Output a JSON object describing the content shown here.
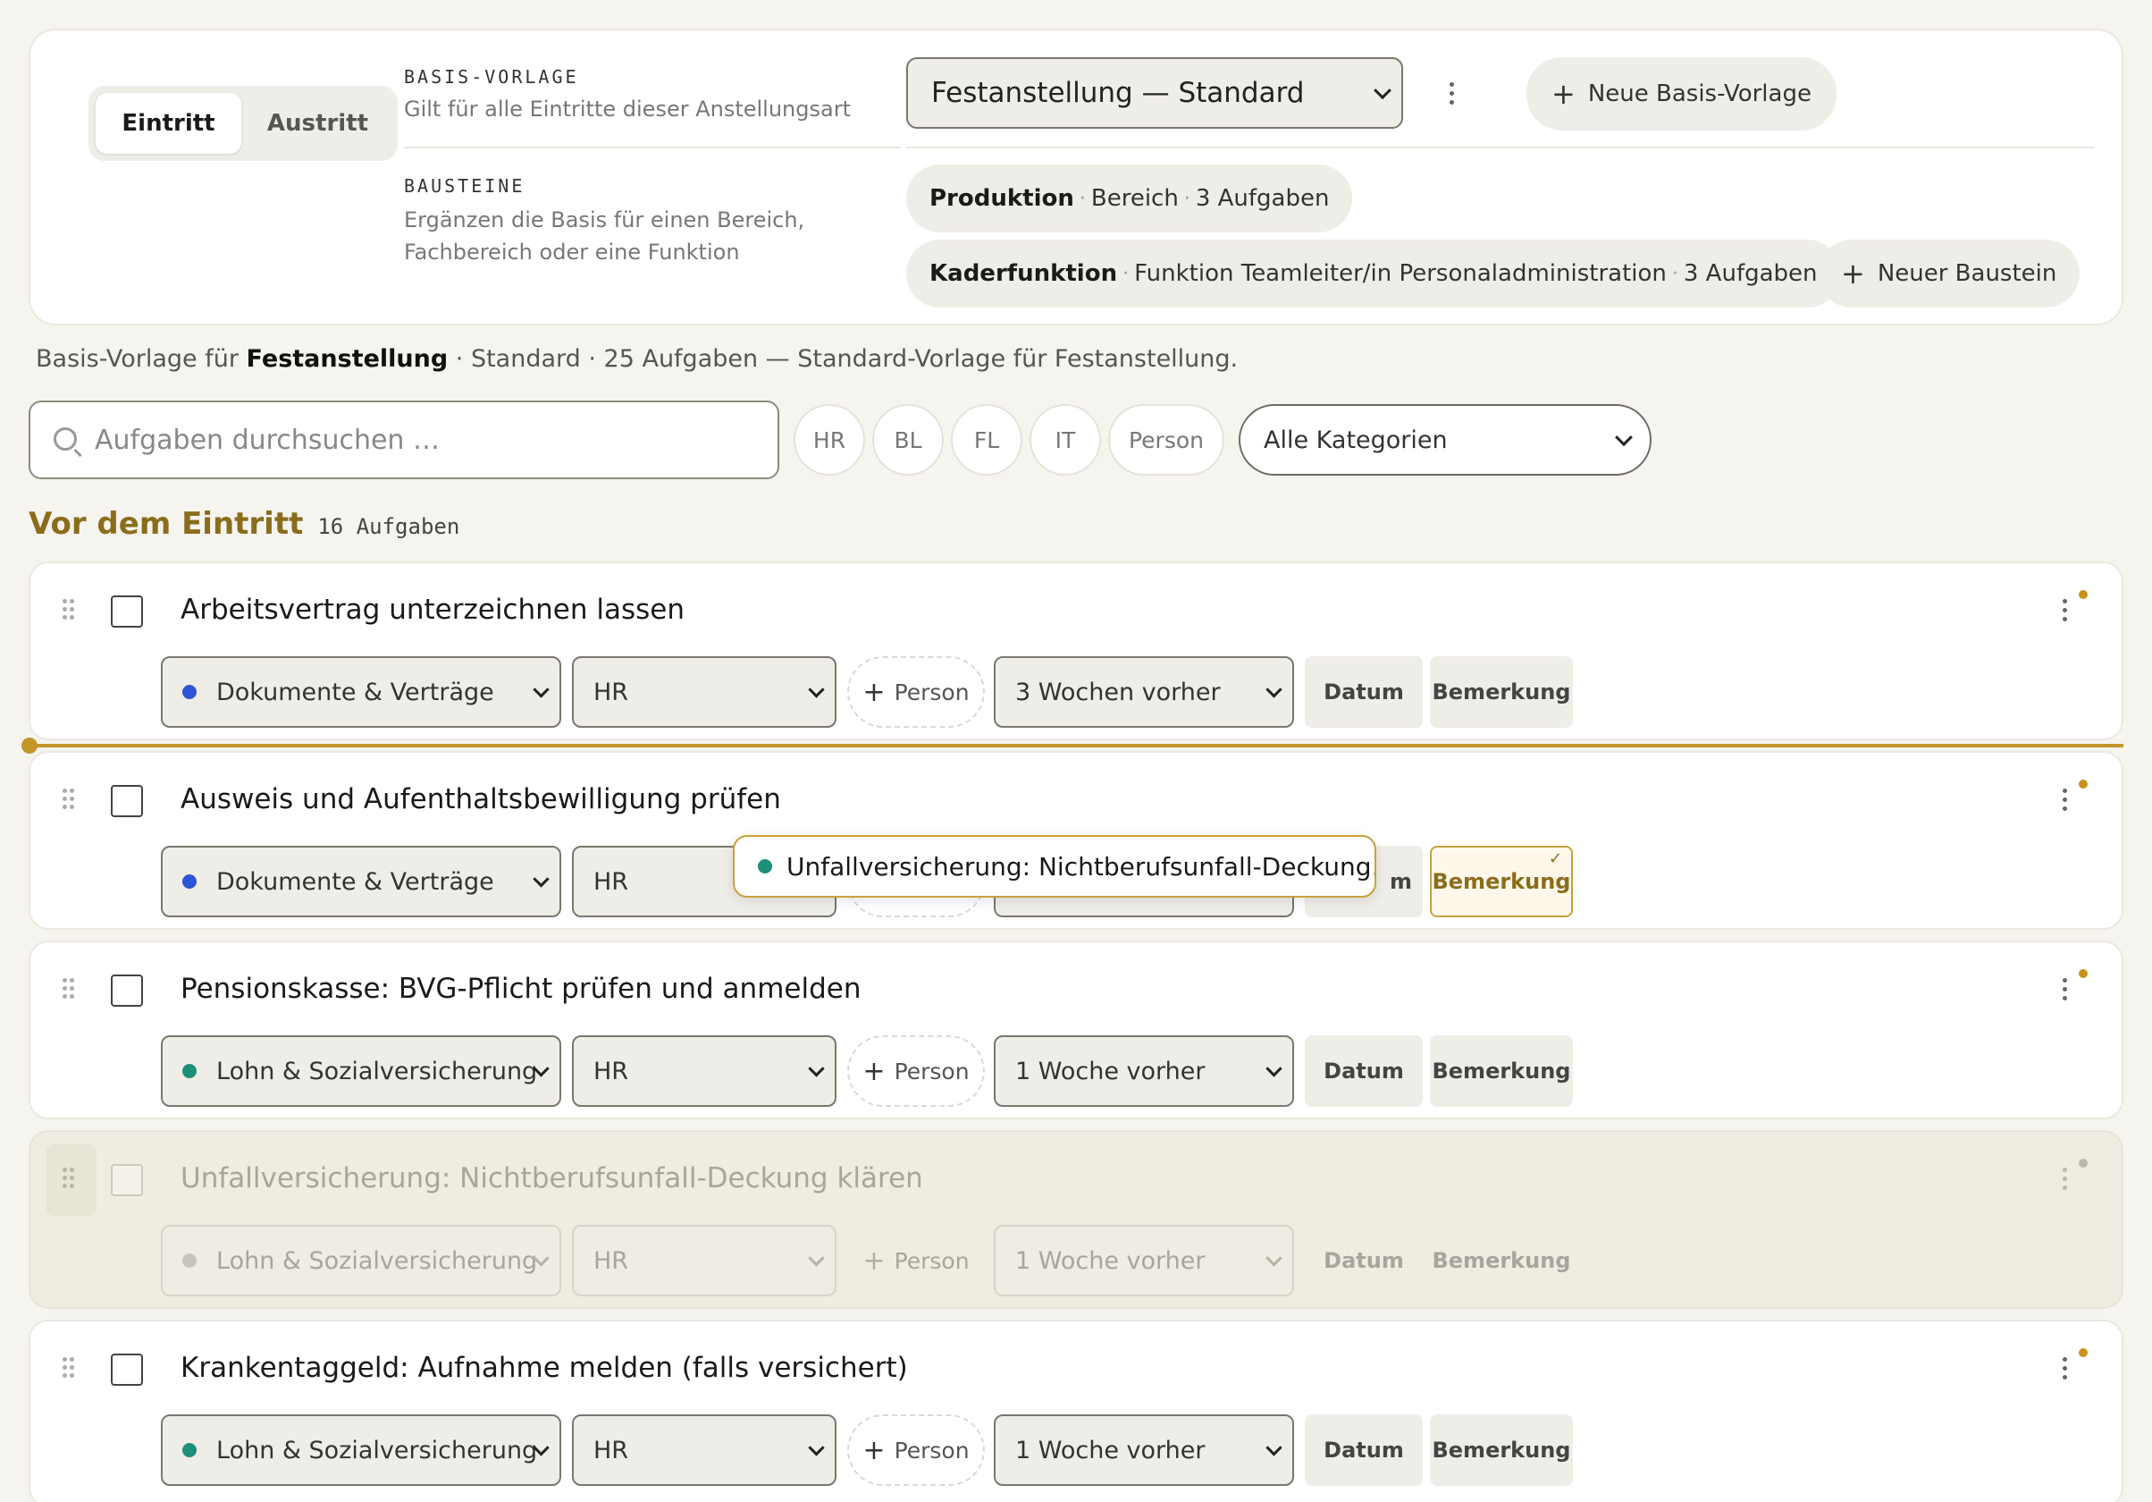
{
  "colors": {
    "accent": "#c3962a",
    "section_title": "#8a6d1b",
    "category_documents": "#2f55d4",
    "category_payroll": "#1f8f7a",
    "category_disabled": "#c8c5bc"
  },
  "mode_toggle": {
    "entry": "Eintritt",
    "exit": "Austritt",
    "active": "Eintritt"
  },
  "base_template": {
    "label": "BASIS-VORLAGE",
    "description": "Gilt für alle Eintritte dieser Anstellungsart",
    "selected": "Festanstellung — Standard",
    "new_button": "Neue Basis-Vorlage"
  },
  "building_blocks": {
    "label": "BAUSTEINE",
    "description_line1": "Ergänzen die Basis für einen Bereich,",
    "description_line2": "Fachbereich oder eine Funktion",
    "items": [
      {
        "name": "Produktion",
        "type": "Bereich",
        "count": "3 Aufgaben"
      },
      {
        "name": "Kaderfunktion",
        "type": "Funktion Teamleiter/in Personaladministration",
        "count": "3 Aufgaben"
      }
    ],
    "new_button": "Neuer Baustein"
  },
  "summary": {
    "prefix": "Basis-Vorlage für ",
    "employment_type": "Festanstellung",
    "rest": " · Standard · 25 Aufgaben — Standard-Vorlage für Festanstellung."
  },
  "filters": {
    "search_placeholder": "Aufgaben durchsuchen …",
    "chips": [
      "HR",
      "BL",
      "FL",
      "IT",
      "Person"
    ],
    "category_select": "Alle Kategorien"
  },
  "group": {
    "title": "Vor dem Eintritt",
    "count": "16 Aufgaben"
  },
  "field_labels": {
    "person": "Person",
    "date": "Datum",
    "remark": "Bemerkung"
  },
  "tasks": [
    {
      "title": "Arbeitsvertrag unterzeichnen lassen",
      "category": "Dokumente & Verträge",
      "category_color": "#2f55d4",
      "role": "HR",
      "timing": "3 Wochen vorher"
    },
    {
      "title": "Ausweis und Aufenthaltsbewilligung prüfen",
      "category": "Dokumente & Verträge",
      "category_color": "#2f55d4",
      "role": "HR",
      "timing": "",
      "date_fragment": "m"
    },
    {
      "title": "Pensionskasse: BVG-Pflicht prüfen und anmelden",
      "category": "Lohn & Sozialversicherung",
      "category_color": "#1f8f7a",
      "role": "HR",
      "timing": "1 Woche vorher"
    },
    {
      "title": "Unfallversicherung: Nichtberufsunfall-Deckung klären",
      "category": "Lohn & Sozialversicherung",
      "category_color": "#c8c5bc",
      "role": "HR",
      "timing": "1 Woche vorher"
    },
    {
      "title": "Krankentaggeld: Aufnahme melden (falls versichert)",
      "category": "Lohn & Sozialversicherung",
      "category_color": "#1f8f7a",
      "role": "HR",
      "timing": "1 Woche vorher"
    }
  ],
  "drag_preview": {
    "label": "Unfallversicherung: Nichtberufsunfall-Deckung…",
    "category_color": "#1f8f7a"
  }
}
